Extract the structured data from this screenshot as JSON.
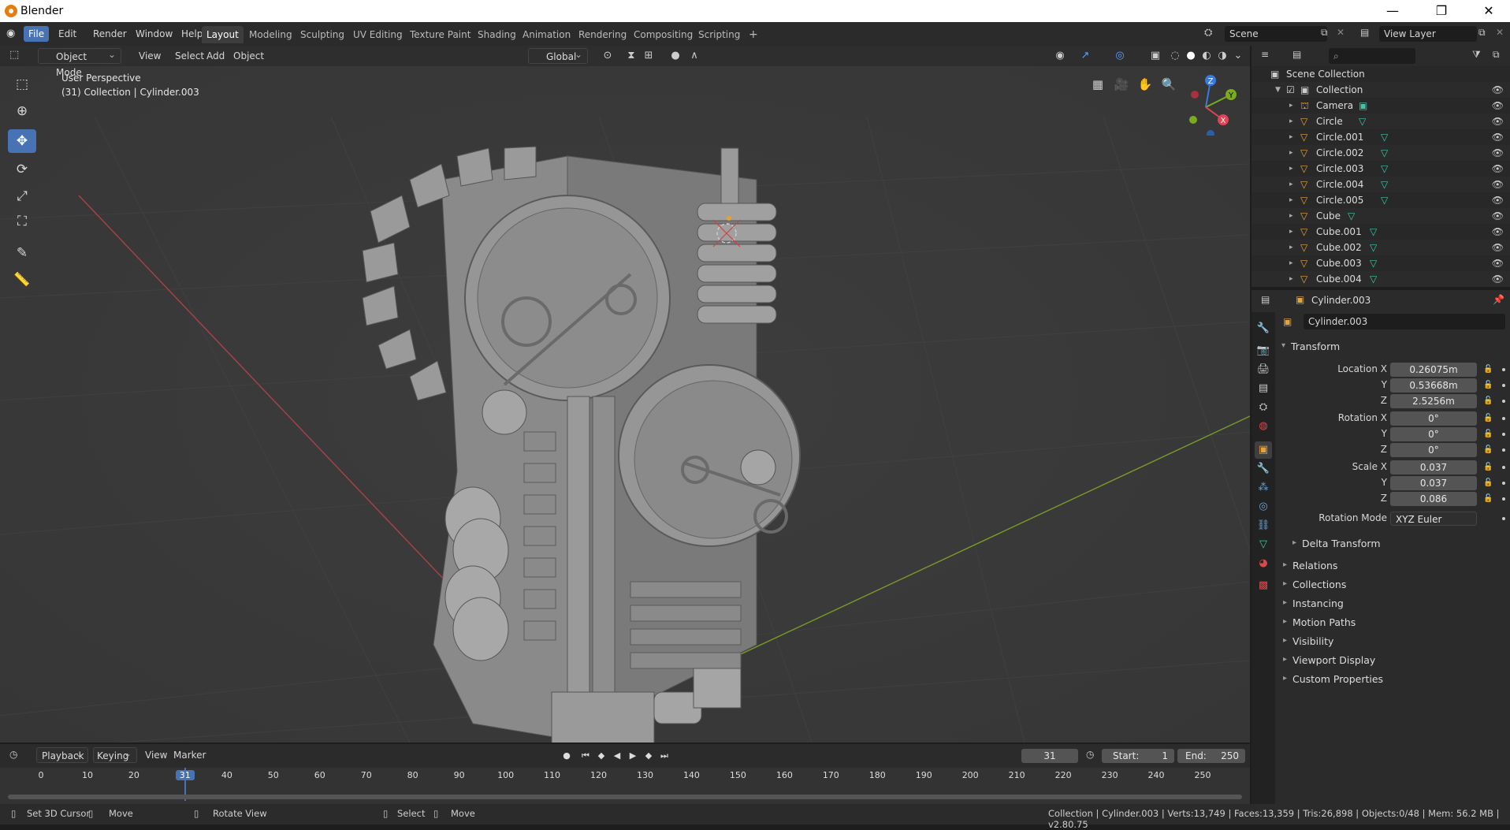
{
  "window": {
    "title": "Blender",
    "minimize": "—",
    "maximize": "❐",
    "close": "✕"
  },
  "menu": [
    "File",
    "Edit",
    "Render",
    "Window",
    "Help"
  ],
  "workspaces": [
    "Layout",
    "Modeling",
    "Sculpting",
    "UV Editing",
    "Texture Paint",
    "Shading",
    "Animation",
    "Rendering",
    "Compositing",
    "Scripting"
  ],
  "workspace_add": "+",
  "scene": {
    "name": "Scene",
    "view_layer": "View Layer"
  },
  "viewport": {
    "mode": "Object Mode",
    "menus": [
      "View",
      "Select",
      "Add",
      "Object"
    ],
    "orientation": "Global",
    "perspective": "User Perspective",
    "context": "(31) Collection | Cylinder.003",
    "gizmo": {
      "x": "X",
      "y": "Y",
      "z": "Z"
    }
  },
  "outliner": {
    "root": "Scene Collection",
    "collection": "Collection",
    "items": [
      "Camera",
      "Circle",
      "Circle.001",
      "Circle.002",
      "Circle.003",
      "Circle.004",
      "Circle.005",
      "Cube",
      "Cube.001",
      "Cube.002",
      "Cube.003",
      "Cube.004"
    ]
  },
  "properties": {
    "object_name": "Cylinder.003",
    "field_name": "Cylinder.003",
    "transform_header": "Transform",
    "location": {
      "label": "Location X",
      "x": "0.26075m",
      "y": "0.53668m",
      "z": "2.5256m"
    },
    "rotation": {
      "label": "Rotation X",
      "x": "0°",
      "y": "0°",
      "z": "0°"
    },
    "scale": {
      "label": "Scale X",
      "x": "0.037",
      "y": "0.037",
      "z": "0.086"
    },
    "axis_y": "Y",
    "axis_z": "Z",
    "rotation_mode_label": "Rotation Mode",
    "rotation_mode": "XYZ Euler",
    "delta_transform": "Delta Transform",
    "sections": [
      "Relations",
      "Collections",
      "Instancing",
      "Motion Paths",
      "Visibility",
      "Viewport Display",
      "Custom Properties"
    ]
  },
  "timeline": {
    "menus": [
      "Playback",
      "Keying",
      "View",
      "Marker"
    ],
    "current_frame": "31",
    "start_label": "Start:",
    "start": "1",
    "end_label": "End:",
    "end": "250",
    "ticks": [
      "0",
      "10",
      "20",
      "31",
      "40",
      "50",
      "60",
      "70",
      "80",
      "90",
      "100",
      "110",
      "120",
      "130",
      "140",
      "150",
      "160",
      "170",
      "180",
      "190",
      "200",
      "210",
      "220",
      "230",
      "240",
      "250"
    ]
  },
  "status": {
    "left1": "Set 3D Cursor",
    "left2": "Move",
    "mid1": "Rotate View",
    "right1": "Select",
    "right2": "Move",
    "stats": "Collection | Cylinder.003 | Verts:13,749 | Faces:13,359 | Tris:26,898 | Objects:0/48 | Mem: 56.2 MB | v2.80.75"
  }
}
